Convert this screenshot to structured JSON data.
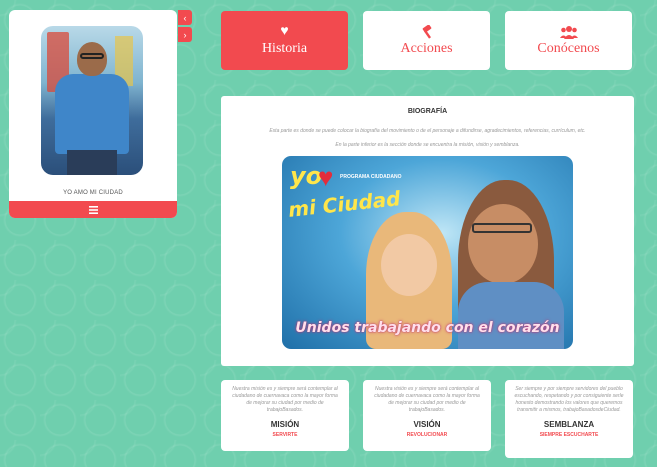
{
  "profile": {
    "caption": "YO AMO MI CIUDAD",
    "menu_icon": "hamburger-icon"
  },
  "slider": {
    "prev_icon": "chevron-left-icon",
    "next_icon": "chevron-right-icon",
    "prev": "‹",
    "next": "›"
  },
  "nav": [
    {
      "label": "Historia",
      "icon": "heart-icon",
      "glyph": "♥",
      "active": true
    },
    {
      "label": "Acciones",
      "icon": "gavel-icon",
      "glyph": "🔨",
      "active": false
    },
    {
      "label": "Conócenos",
      "icon": "users-icon",
      "glyph": "👥",
      "active": false
    }
  ],
  "bio": {
    "title": "BIOGRAFÍA",
    "line1": "Esta parte es donde se puede colocar la biografía del movimiento o de el personaje a difundirse, agradecimientos, referencias, currículum, etc.",
    "line2": "En la parte inferior es la sección donde se encuentra la misión, visión y semblanza.",
    "banner": {
      "logo_yo": "yo",
      "logo_tag": "PROGRAMA CIUDADANO",
      "logo_ciudad": "mi Ciudad",
      "slogan": "Unidos trabajando con el corazón"
    }
  },
  "cards": [
    {
      "text": "Nuestra misión es y siempre será contemplar al ciudadano de cuernavaca como la mayor forma de mejorar su ciudad por medio de trabajoBasados.",
      "title": "MISIÓN",
      "sub": "SERVIRTE"
    },
    {
      "text": "Nuestra visión es y siempre será contemplar al ciudadano de cuernavaca como la mayor forma de mejorar su ciudad por medio de trabajoBasados.",
      "title": "VISIÓN",
      "sub": "REVOLUCIONAR"
    },
    {
      "text": "Ser siempre y por siempre servidores del pueblo escuchando, respetando y por consiguiente serle honesto demostrando los valores que queremos transmitir a mismos, trabajoBasadosdeCiudad.",
      "title": "SEMBLANZA",
      "sub": "SIEMPRE ESCUCHARTE"
    }
  ],
  "colors": {
    "accent": "#f24a4f",
    "background": "#6fcfae"
  }
}
